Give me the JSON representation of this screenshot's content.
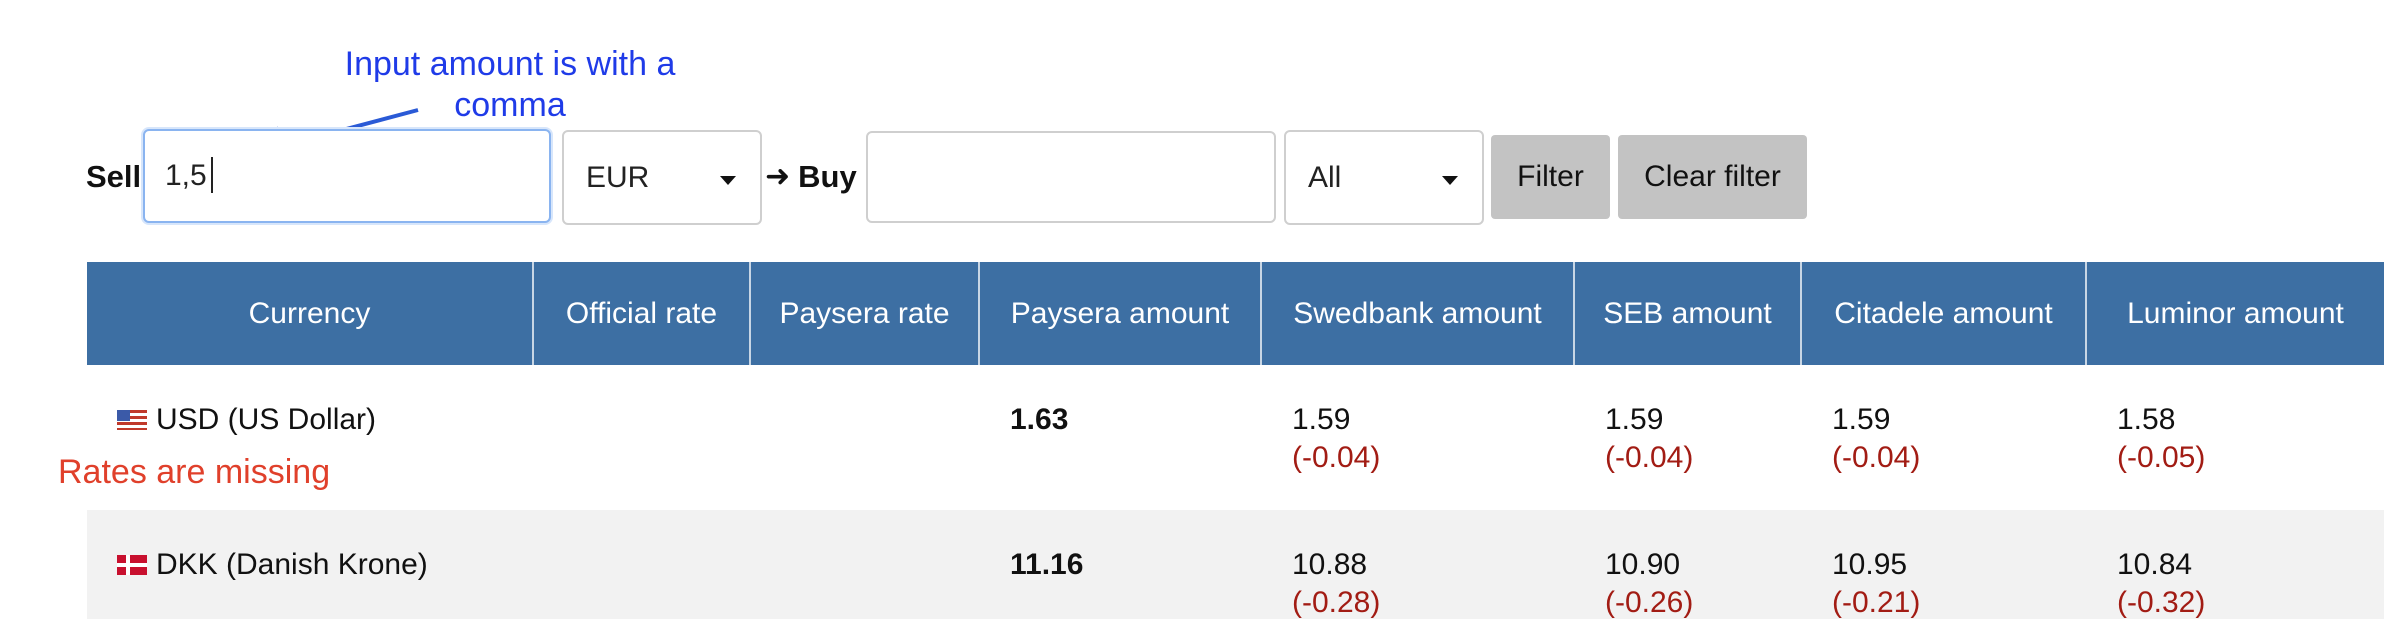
{
  "annotations": {
    "input_note": "Input amount is with a comma",
    "rates_note": "Rates are missing"
  },
  "filter_bar": {
    "sell_label": "Sell",
    "sell_amount_value": "1,5",
    "sell_currency": "EUR",
    "buy_label": "Buy",
    "buy_amount_value": "",
    "buy_currency": "All",
    "filter_button": "Filter",
    "clear_filter_button": "Clear filter"
  },
  "table": {
    "headers": [
      "Currency",
      "Official rate",
      "Paysera rate",
      "Paysera amount",
      "Swedbank amount",
      "SEB amount",
      "Citadele amount",
      "Luminor amount"
    ],
    "rows": [
      {
        "flag": "us-flag-icon",
        "currency": "USD (US Dollar)",
        "official_rate": "",
        "paysera_rate": "",
        "paysera_amount": "1.63",
        "swedbank_amount": "1.59",
        "swedbank_diff": "(-0.04)",
        "seb_amount": "1.59",
        "seb_diff": "(-0.04)",
        "citadele_amount": "1.59",
        "citadele_diff": "(-0.04)",
        "luminor_amount": "1.58",
        "luminor_diff": "(-0.05)"
      },
      {
        "flag": "dk-flag-icon",
        "currency": "DKK (Danish Krone)",
        "official_rate": "",
        "paysera_rate": "",
        "paysera_amount": "11.16",
        "swedbank_amount": "10.88",
        "swedbank_diff": "(-0.28)",
        "seb_amount": "10.90",
        "seb_diff": "(-0.26)",
        "citadele_amount": "10.95",
        "citadele_diff": "(-0.21)",
        "luminor_amount": "10.84",
        "luminor_diff": "(-0.32)"
      }
    ]
  },
  "colors": {
    "header_bg": "#3d6fa3",
    "annotation_blue": "#1f3be8",
    "annotation_red": "#e0402b",
    "diff_red": "#a21c14",
    "button_gray": "#c3c3c3"
  }
}
